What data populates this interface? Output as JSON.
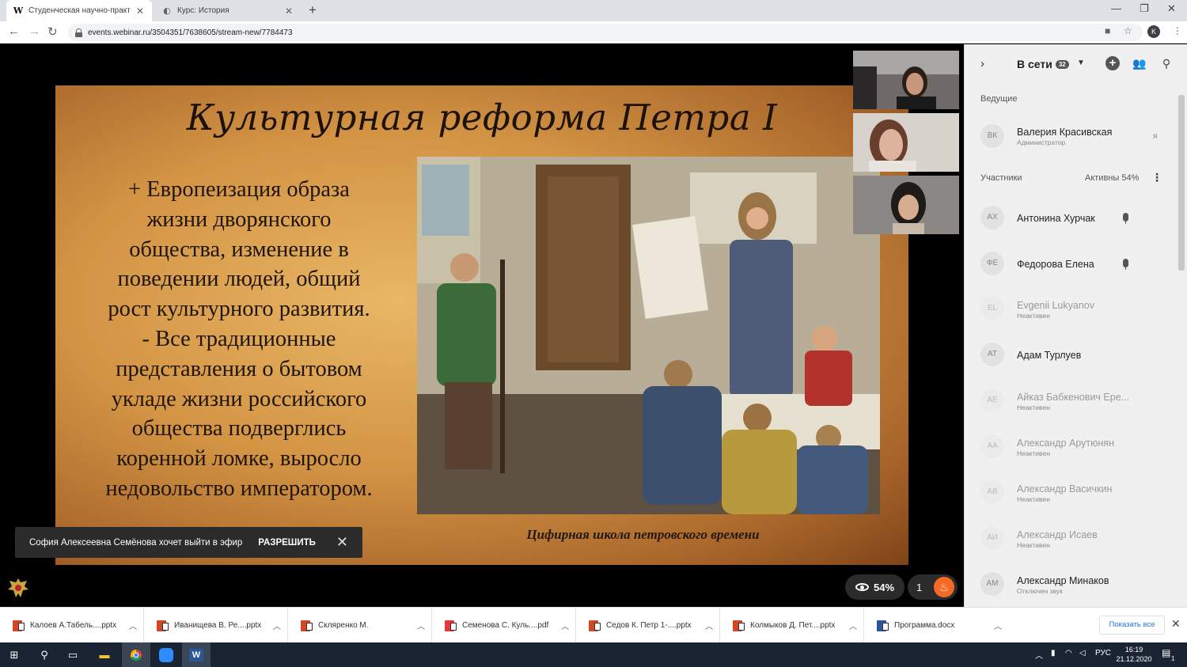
{
  "browser": {
    "tabs": [
      {
        "favicon": "W",
        "title": "Студенческая научно-практ",
        "active": true
      },
      {
        "favicon": "",
        "title": "Курс: История",
        "active": false
      }
    ],
    "url": "events.webinar.ru/3504351/7638605/stream-new/7784473",
    "profile_initial": "K"
  },
  "slide": {
    "title": "Культурная реформа Петра I",
    "body_lines": [
      "+ Европеизация образа",
      "жизни дворянского",
      "общества, изменение в",
      "поведении людей, общий",
      "рост культурного развития.",
      "- Все традиционные",
      "представления о бытовом",
      "укладе жизни российского",
      "общества подверглись",
      "коренной ломке, выросло",
      "недовольство императором."
    ],
    "caption": "Цифирная школа петровского времени"
  },
  "toast": {
    "message": "София Алексеевна Семёнова хочет выйти в эфир",
    "allow_label": "РАЗРЕШИТЬ"
  },
  "stats": {
    "viewers_percent": "54%",
    "reactions": "1"
  },
  "sidebar": {
    "title": "В сети",
    "online_count": "32",
    "hosts_label": "Ведущие",
    "host": {
      "initials": "ВК",
      "name": "Валерия Красивская",
      "role": "Администратор",
      "me": "я"
    },
    "participants_label": "Участники",
    "active_label": "Активны 54%",
    "participants": [
      {
        "initials": "АХ",
        "name": "Антонина Хурчак",
        "status": "",
        "mic": true,
        "dim": false
      },
      {
        "initials": "ФЕ",
        "name": "Федорова Елена",
        "status": "",
        "mic": true,
        "dim": false
      },
      {
        "initials": "EL",
        "name": "Evgenii Lukyanov",
        "status": "Неактивен",
        "mic": false,
        "dim": true
      },
      {
        "initials": "АТ",
        "name": "Адам Турлуев",
        "status": "",
        "mic": false,
        "dim": false
      },
      {
        "initials": "АЕ",
        "name": "Айказ Бабкенович Ере...",
        "status": "Неактивен",
        "mic": false,
        "dim": true
      },
      {
        "initials": "АА",
        "name": "Александр Арутюнян",
        "status": "Неактивен",
        "mic": false,
        "dim": true
      },
      {
        "initials": "АВ",
        "name": "Александр Васичкин",
        "status": "Неактивен",
        "mic": false,
        "dim": true
      },
      {
        "initials": "АИ",
        "name": "Александр Исаев",
        "status": "Неактивен",
        "mic": false,
        "dim": true
      },
      {
        "initials": "АМ",
        "name": "Александр Минаков",
        "status": "Отключен звук",
        "mic": false,
        "dim": false
      }
    ]
  },
  "downloads": {
    "items": [
      {
        "name": "Калоев А.Табель....pptx",
        "type": "ppt"
      },
      {
        "name": "Иванищева В. Ре....pptx",
        "type": "ppt"
      },
      {
        "name": "Скляренко М.",
        "type": "ppt"
      },
      {
        "name": "Семенова С. Куль....pdf",
        "type": "pdf"
      },
      {
        "name": "Седов К. Петр 1-....pptx",
        "type": "ppt"
      },
      {
        "name": "Колмыков Д. Пет....pptx",
        "type": "ppt"
      },
      {
        "name": "Программа.docx",
        "type": "doc"
      }
    ],
    "show_all": "Показать все"
  },
  "taskbar": {
    "lang": "РУС",
    "time": "16:19",
    "date": "21.12.2020",
    "notif_count": "1"
  },
  "colors": {
    "accent": "#f46a25",
    "slide_bg": "#d39444",
    "sidebar_bg": "#f0f0f0"
  }
}
